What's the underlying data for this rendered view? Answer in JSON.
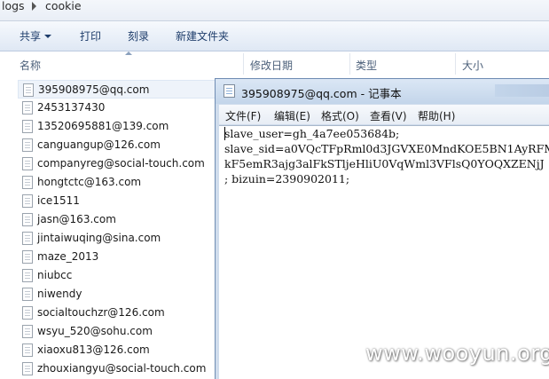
{
  "breadcrumb": {
    "parent": "logs",
    "current": "cookie"
  },
  "toolbar": {
    "share": "共享",
    "print": "打印",
    "burn": "刻录",
    "new_folder": "新建文件夹"
  },
  "columns": {
    "name": "名称",
    "modified": "修改日期",
    "type": "类型",
    "size": "大小"
  },
  "files": [
    "395908975@qq.com",
    "2453137430",
    "13520695881@139.com",
    "canguangup@126.com",
    "companyreg@social-touch.com",
    "hongtctc@163.com",
    "ice1511",
    "jasn@163.com",
    "jintaiwuqing@sina.com",
    "maze_2013",
    "niubcc",
    "niwendy",
    "socialtouchzr@126.com",
    "wsyu_520@sohu.com",
    "xiaoxu813@126.com",
    "zhouxiangyu@social-touch.com"
  ],
  "notepad": {
    "title": "395908975@qq.com - 记事本",
    "menu": [
      "文件(F)",
      "编辑(E)",
      "格式(O)",
      "查看(V)",
      "帮助(H)"
    ],
    "lines": [
      "slave_user=gh_4a7ee053684b;",
      "slave_sid=a0VQcTFpRml0d3JGVXE0MndKOE5BN1AyRFMz",
      "kF5emR3ajg3alFkSTljeHliU0VqWml3VFlsQ0YOQXZENjJ",
      "; bizuin=2390902011;"
    ]
  },
  "watermark": "www.wooyun.org"
}
